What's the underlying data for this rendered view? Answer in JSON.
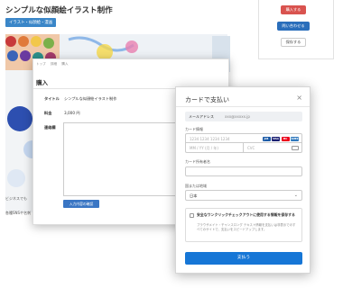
{
  "page": {
    "title": "シンプルな似顔絵イラスト制作",
    "category_badge": "イラスト・似顔絵・漫画",
    "description_line1": "ビジネスでも",
    "description_line2": "各種SNSや名刺"
  },
  "sidebar": {
    "buy_label": "購入する",
    "inquiry_label": "問い合わせる",
    "favorite_label": "保存する"
  },
  "purchase_modal": {
    "breadcrumb": [
      "トップ",
      "詳細",
      "購入"
    ],
    "title": "購入",
    "labels": {
      "title": "タイトル",
      "price": "料金",
      "message": "連絡欄"
    },
    "values": {
      "title": "シンプルな似顔絵イラスト制作",
      "price": "3,000 円"
    },
    "confirm_label": "入力内容の確認"
  },
  "stripe_checkout": {
    "title": "カードで支払い",
    "close_icon": "×",
    "email_label": "メールアドレス",
    "email_value": "xxx@xxxxx.jp",
    "card_label": "カード情報",
    "card_number_placeholder": "1234 1234 1234 1234",
    "brands": [
      {
        "name": "JCB",
        "color": "#1b5aa6"
      },
      {
        "name": "VISA",
        "color": "#1a1f71"
      },
      {
        "name": "MC",
        "color": "#eb001b"
      },
      {
        "name": "AMEX",
        "color": "#2e77bc"
      }
    ],
    "expiry_placeholder": "MM / YY (月 / 年)",
    "cvc_placeholder": "CVC",
    "holder_label": "カード所有者名",
    "country_label": "国または地域",
    "country_value": "日本",
    "save_title": "安全なワンクリックチェックアウトに使用する情報を保存する",
    "save_body": "ブラウザメイト・チャンスロング テキスト情報を支払いは非表示でのすべてのサイトで、支払いをスピードアップします。",
    "pay_label": "支払う"
  }
}
